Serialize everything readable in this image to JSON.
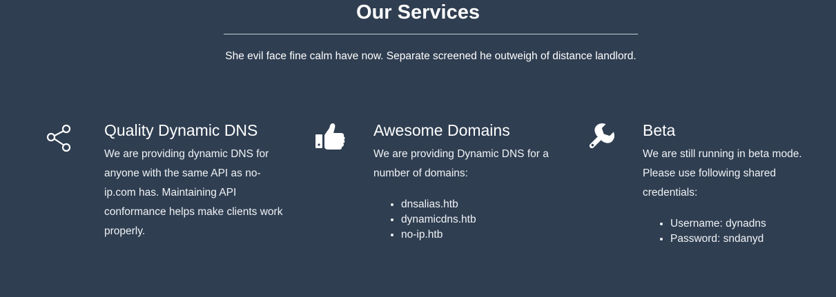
{
  "section": {
    "title": "Our Services",
    "subtitle": "She evil face fine calm have now. Separate screened he outweigh of distance landlord."
  },
  "services": [
    {
      "icon": "share-icon",
      "title": "Quality Dynamic DNS",
      "description": "We are providing dynamic DNS for anyone with the same API as no-ip.com has. Maintaining API conformance helps make clients work properly.",
      "items": []
    },
    {
      "icon": "thumbs-up-icon",
      "title": "Awesome Domains",
      "description": "We are providing Dynamic DNS for a number of domains:",
      "items": [
        "dnsalias.htb",
        "dynamicdns.htb",
        "no-ip.htb"
      ]
    },
    {
      "icon": "wrench-icon",
      "title": "Beta",
      "description": "We are still running in beta mode. Please use following shared credentials:",
      "items": [
        "Username: dynadns",
        "Password: sndanyd"
      ]
    }
  ]
}
